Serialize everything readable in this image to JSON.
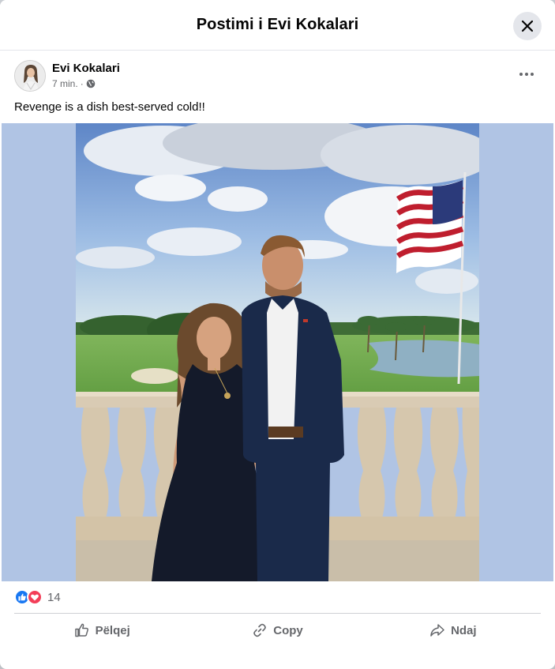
{
  "modal": {
    "title": "Postimi i Evi Kokalari"
  },
  "post": {
    "author": "Evi Kokalari",
    "time": "7 min.",
    "separator": "·",
    "privacy_icon": "globe-icon",
    "caption": "Revenge is a dish best-served cold!!"
  },
  "reactions": {
    "icons": [
      "like-icon",
      "love-icon"
    ],
    "count": "14"
  },
  "actions": {
    "like_label": "Pëlqej",
    "copy_label": "Copy",
    "share_label": "Ndaj"
  },
  "colors": {
    "like": "#1877f2",
    "love": "#f33e58",
    "photo_background": "#b0c4e4",
    "secondary_text": "#65676b"
  }
}
